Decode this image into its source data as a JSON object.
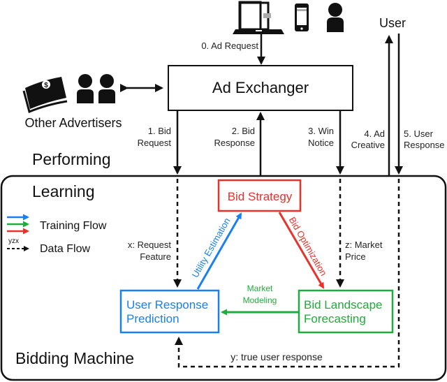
{
  "title": "Bidding machine diagram",
  "colors": {
    "blue": "#1a7ff0",
    "green": "#1fab3d",
    "red": "#e8322a",
    "black": "#111111"
  },
  "top": {
    "devices": [
      "laptop-icon",
      "smartphone-icon",
      "person-icon"
    ],
    "ad_request": "0. Ad Request",
    "ad_exchanger": "Ad Exchanger",
    "user": "User",
    "other_advertisers": "Other Advertisers",
    "adv_icons": [
      "money-icon",
      "people-icon"
    ]
  },
  "flows": {
    "bid_request": [
      "1. Bid",
      "Request"
    ],
    "bid_response": [
      "2. Bid",
      "Response"
    ],
    "win_notice": [
      "3. Win",
      "Notice"
    ],
    "ad_creative": [
      "4. Ad",
      "Creative"
    ],
    "user_response": [
      "5. User",
      "Response"
    ]
  },
  "machine": {
    "performing": "Performing",
    "learning": "Learning",
    "bidding_machine": "Bidding Machine",
    "legend": {
      "training": "Training Flow",
      "data": "Data Flow",
      "data_tag": "yzx"
    },
    "x_label": [
      "x: Request",
      "Feature"
    ],
    "z_label": [
      "z: Market",
      "Price"
    ],
    "y_label": "y: true user response",
    "bid_strategy": "Bid Strategy",
    "urp": [
      "User Response",
      "Prediction"
    ],
    "blf": [
      "Bid Landscape",
      "Forecasting"
    ],
    "utility_estimation": "Utility Estimation",
    "bid_optimization": "Bid Optimization",
    "market_modeling": [
      "Market",
      "Modeling"
    ]
  }
}
